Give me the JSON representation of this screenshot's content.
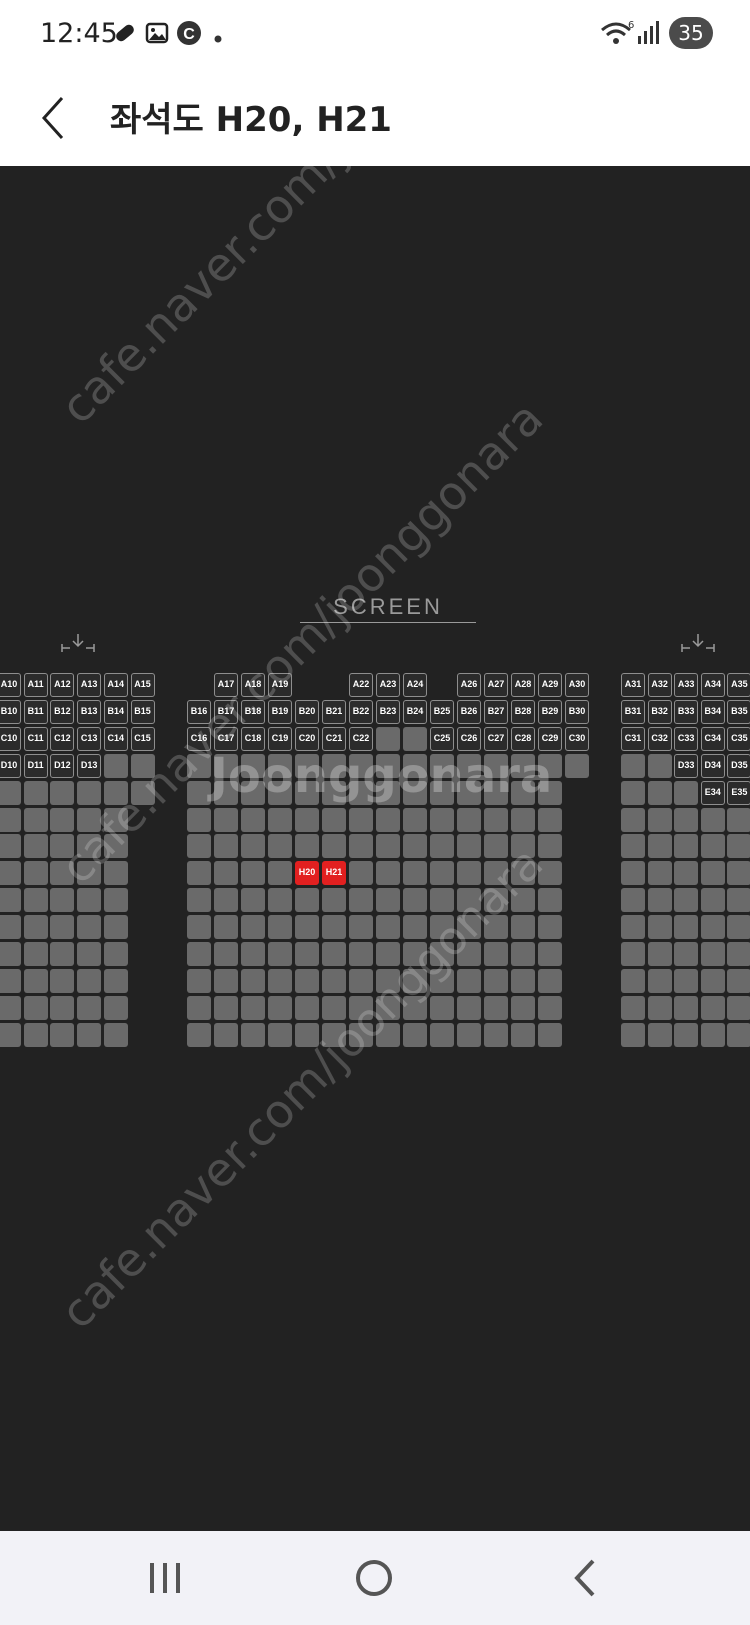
{
  "status_bar": {
    "time": "12:45",
    "battery": "35",
    "icons": [
      "vpn-key-icon",
      "gallery-icon",
      "c-icon",
      "dot-icon",
      "wifi-icon",
      "signal-icon"
    ]
  },
  "header": {
    "title": "좌석도 H20, H21",
    "back_icon": "chevron-left-icon"
  },
  "seatmap": {
    "screen_label": "SCREEN",
    "watermark": "cafe.naver.com/joonggonara",
    "logo_watermark": "Joonggonara",
    "colors": {
      "background": "#222222",
      "seat": "#6a6a6a",
      "labeled_seat_border": "#8e8e8e",
      "selected_seat": "#e22020"
    },
    "selected_seats": [
      "H20",
      "H21"
    ],
    "labeled_seats": {
      "A": [
        "A10",
        "A11",
        "A12",
        "A13",
        "A14",
        "A15",
        "A17",
        "A18",
        "A19",
        "A22",
        "A23",
        "A24",
        "A26",
        "A27",
        "A28",
        "A29",
        "A30",
        "A31",
        "A32",
        "A33",
        "A34",
        "A35"
      ],
      "B": [
        "B10",
        "B11",
        "B12",
        "B13",
        "B14",
        "B15",
        "B16",
        "B17",
        "B18",
        "B19",
        "B20",
        "B21",
        "B22",
        "B23",
        "B24",
        "B25",
        "B26",
        "B27",
        "B28",
        "B29",
        "B30",
        "B31",
        "B32",
        "B33",
        "B34",
        "B35"
      ],
      "C": [
        "C10",
        "C11",
        "C12",
        "C13",
        "C14",
        "C15",
        "C16",
        "C17",
        "C18",
        "C19",
        "C20",
        "C21",
        "C22",
        "C25",
        "C26",
        "C27",
        "C28",
        "C29",
        "C30",
        "C31",
        "C32",
        "C33",
        "C34",
        "C35"
      ],
      "D": [
        "D10",
        "D11",
        "D12",
        "D13",
        "D33",
        "D34",
        "D35"
      ],
      "E": [
        "E34",
        "E35"
      ]
    }
  },
  "nav_bar": {
    "recent_icon": "recent-apps-icon",
    "home_icon": "home-icon",
    "back_icon": "back-icon"
  }
}
